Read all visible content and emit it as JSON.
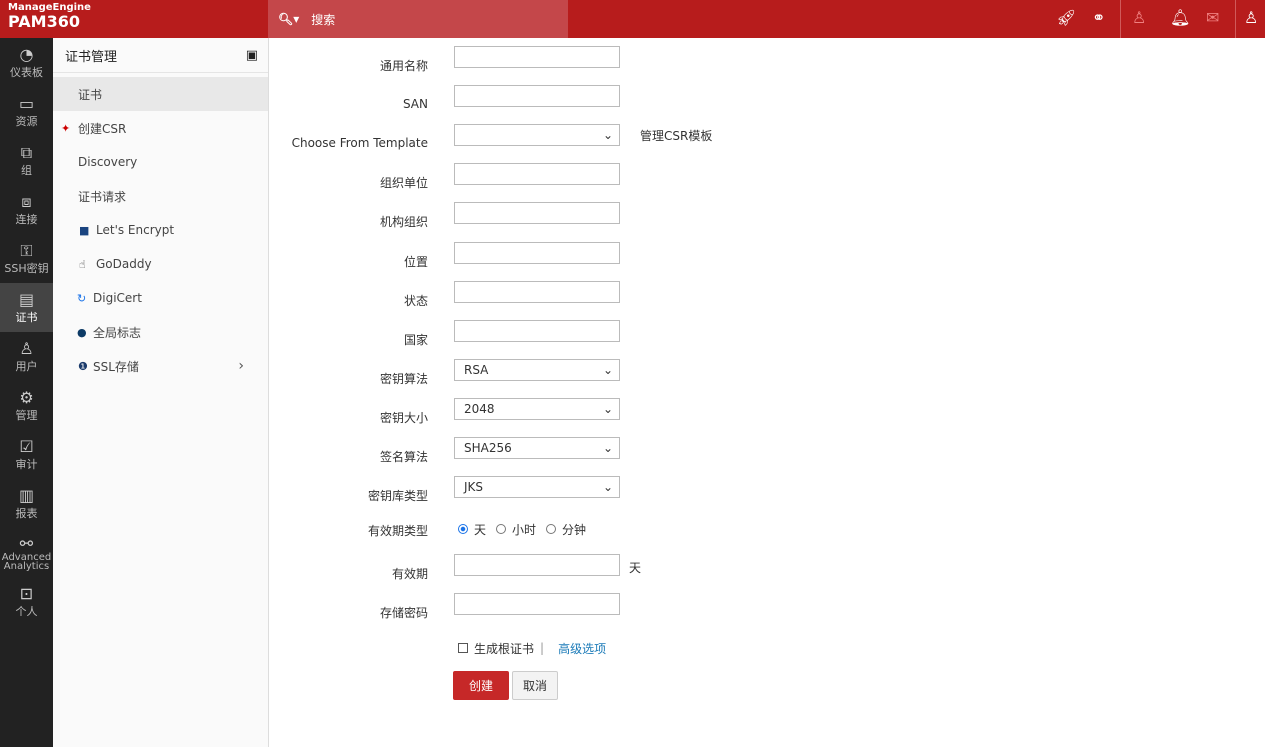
{
  "header": {
    "brand_top": "ManageEngine",
    "brand": "PAM360",
    "search_placeholder": "搜索"
  },
  "nav": [
    {
      "label": "仪表板",
      "icon": "◔"
    },
    {
      "label": "资源",
      "icon": "▭"
    },
    {
      "label": "组",
      "icon": "⧉"
    },
    {
      "label": "连接",
      "icon": "⧈"
    },
    {
      "label": "SSH密钥",
      "icon": "⚿"
    },
    {
      "label": "证书",
      "icon": "▤"
    },
    {
      "label": "用户",
      "icon": "♙"
    },
    {
      "label": "管理",
      "icon": "⚙"
    },
    {
      "label": "审计",
      "icon": "☑"
    },
    {
      "label": "报表",
      "icon": "▥"
    },
    {
      "label": "Advanced Analytics",
      "icon": "⚯"
    },
    {
      "label": "个人",
      "icon": "⊡"
    }
  ],
  "sidebar": {
    "title": "证书管理",
    "items": [
      {
        "label": "证书",
        "icon": ""
      },
      {
        "label": "创建CSR",
        "icon": "📌"
      },
      {
        "label": "Discovery",
        "icon": ""
      },
      {
        "label": "证书请求",
        "icon": ""
      },
      {
        "label": "Let's Encrypt",
        "icon": "🔒"
      },
      {
        "label": "GoDaddy",
        "icon": "✋"
      },
      {
        "label": "DigiCert",
        "icon": "↻"
      },
      {
        "label": "全局标志",
        "icon": "●"
      },
      {
        "label": "SSL存储",
        "icon": "❶"
      }
    ]
  },
  "form": {
    "common_name": "通用名称",
    "san": "SAN",
    "template": "Choose From Template",
    "manage_template": "管理CSR模板",
    "org_unit": "组织单位",
    "org": "机构组织",
    "location": "位置",
    "state": "状态",
    "country": "国家",
    "key_algo": "密钥算法",
    "key_algo_value": "RSA",
    "key_size": "密钥大小",
    "key_size_value": "2048",
    "sig_algo": "签名算法",
    "sig_algo_value": "SHA256",
    "keystore": "密钥库类型",
    "keystore_value": "JKS",
    "validity_type": "有效期类型",
    "opt_day": "天",
    "opt_hour": "小时",
    "opt_min": "分钟",
    "validity": "有效期",
    "validity_unit": "天",
    "store_pwd": "存储密码",
    "gen_root": "生成根证书",
    "sep": "|",
    "advanced": "高级选项",
    "create": "创建",
    "cancel": "取消"
  }
}
